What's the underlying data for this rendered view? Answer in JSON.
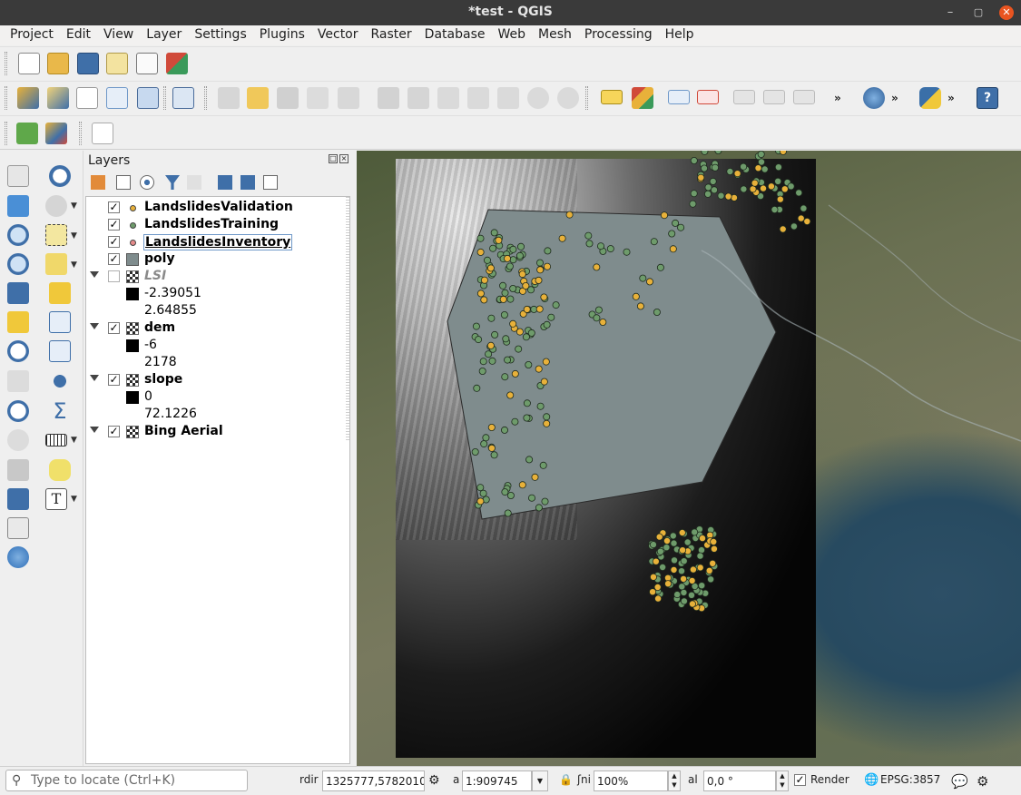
{
  "window": {
    "title": "*test - QGIS"
  },
  "menu": [
    "Project",
    "Edit",
    "View",
    "Layer",
    "Settings",
    "Plugins",
    "Vector",
    "Raster",
    "Database",
    "Web",
    "Mesh",
    "Processing",
    "Help"
  ],
  "layers_panel": {
    "title": "Layers",
    "layers": [
      {
        "name": "LandslidesValidation",
        "checked": true,
        "type": "point",
        "color": "#e8b13a"
      },
      {
        "name": "LandslidesTraining",
        "checked": true,
        "type": "point",
        "color": "#6e9b6b"
      },
      {
        "name": "LandslidesInventory",
        "checked": true,
        "type": "point",
        "color": "#e58a8a",
        "selected": true
      },
      {
        "name": "poly",
        "checked": true,
        "type": "polygon",
        "color": "#7f8c8d"
      },
      {
        "name": "LSI",
        "checked": false,
        "type": "raster",
        "legend_min": "-2.39051",
        "legend_max": "2.64855"
      },
      {
        "name": "dem",
        "checked": true,
        "type": "raster",
        "legend_min": "-6",
        "legend_max": "2178"
      },
      {
        "name": "slope",
        "checked": true,
        "type": "raster",
        "legend_min": "0",
        "legend_max": "72.1226"
      },
      {
        "name": "Bing Aerial",
        "checked": true,
        "type": "raster"
      }
    ]
  },
  "statusbar": {
    "locator_placeholder": "Type to locate (Ctrl+K)",
    "coordinate_label": "rdir",
    "coordinate": "1325777,5782010",
    "scale_label": "a",
    "scale": "1:909745",
    "magnifier_label": "ʃni",
    "magnifier": "100%",
    "rotation_label": "al",
    "rotation": "0,0 °",
    "render_label": "Render",
    "crs": "EPSG:3857"
  },
  "colors": {
    "validation_point": "#e8b13a",
    "training_point": "#6e9b6b",
    "polygon_fill": "#7f8c8d"
  },
  "icons": {
    "window": [
      "minimize-icon",
      "maximize-icon",
      "close-icon"
    ],
    "toolbar_row1": [
      "new-project-icon",
      "open-project-icon",
      "save-project-icon",
      "save-as-icon",
      "print-layout-icon",
      "style-manager-icon"
    ],
    "toolbar_row2": [
      "data-source-manager-icon",
      "new-geopackage-icon",
      "new-shapefile-icon",
      "digitize-icon",
      "virtual-layer-icon",
      "edit-toggle-icon",
      "pencil-icon",
      "save-edits-icon",
      "add-feature-icon",
      "vertex-tool-icon",
      "modify-attributes-icon",
      "delete-icon",
      "cut-icon",
      "copy-icon",
      "paste-icon",
      "undo-icon",
      "redo-icon",
      "label-icon",
      "diagram-icon",
      "pin-label-icon",
      "highlight-label-icon",
      "show-hide-label-icon",
      "move-label-icon",
      "rotate-label-icon",
      "metasearch-icon",
      "python-console-icon",
      "help-icon"
    ],
    "toolbar_row3": [
      "locator-search-icon",
      "qgis-plugin-icon",
      "profile-tool-icon"
    ]
  }
}
